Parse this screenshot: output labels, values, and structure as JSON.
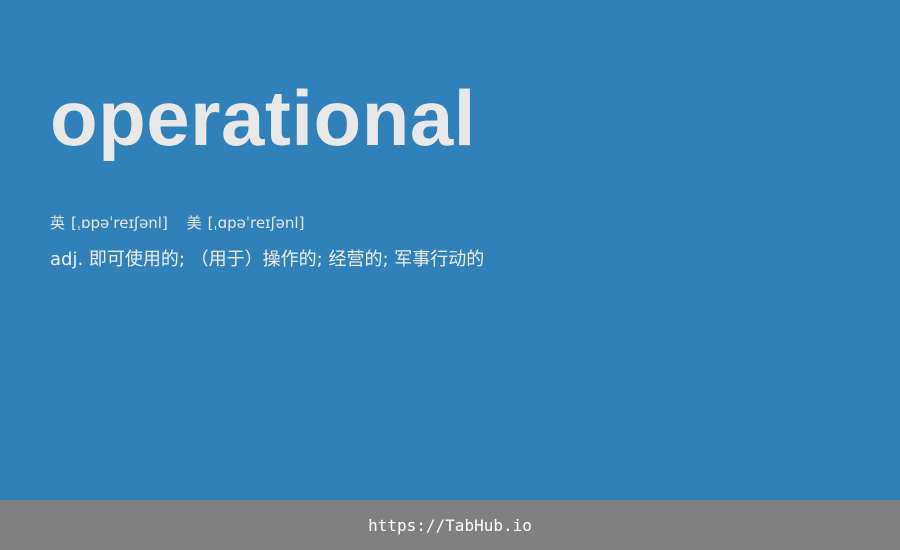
{
  "card": {
    "word": "operational",
    "phonetics": {
      "uk_label": "英",
      "uk_ipa": "[ˌɒpəˈreɪʃənl]",
      "us_label": "美",
      "us_ipa": "[ˌɑpəˈreɪʃənl]"
    },
    "definition": "adj. 即可使用的; （用于）操作的; 经营的; 军事行动的"
  },
  "footer": {
    "link_text": "https://TabHub.io"
  },
  "colors": {
    "background": "#3081b9",
    "footer": "#808080",
    "text": "#e8e8e8"
  }
}
